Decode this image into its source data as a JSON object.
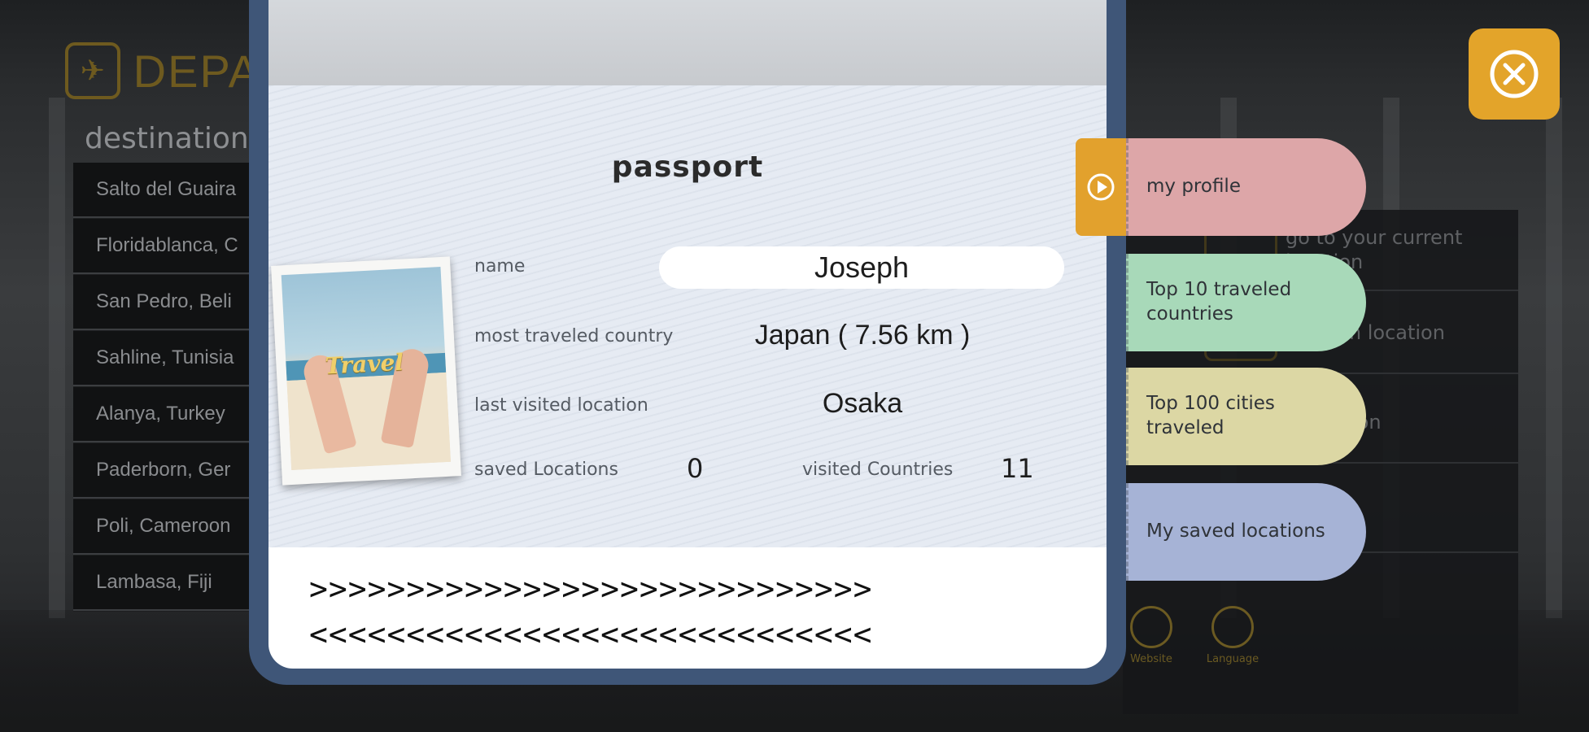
{
  "background": {
    "header_text": "DEPA",
    "destinations_title": "destination",
    "destinations": [
      "Salto del Guaira",
      "Floridablanca, C",
      "San Pedro, Beli",
      "Sahline, Tunisia",
      "Alanya, Turkey",
      "Paderborn, Ger",
      "Poli, Cameroon",
      "Lambasa, Fiji"
    ],
    "right_menu": [
      {
        "label": "go to your current location"
      },
      {
        "label": "random location"
      },
      {
        "label": "a location"
      },
      {
        "label": "rt"
      }
    ],
    "bottom_icons": [
      {
        "label": "Website",
        "icon": "website-icon"
      },
      {
        "label": "Language",
        "icon": "globe-icon"
      }
    ]
  },
  "passport": {
    "title": "passport",
    "photo_caption": "Travel",
    "name_label": "name",
    "name_value": "Joseph",
    "most_traveled_label": "most traveled country",
    "most_traveled_value": "Japan ( 7.56 km )",
    "last_visited_label": "last visited location",
    "last_visited_value": "Osaka",
    "saved_locations_label": "saved Locations",
    "saved_locations_value": "0",
    "visited_countries_label": "visited Countries",
    "visited_countries_value": "11",
    "mrz_line1": ">>>>>>>>>>>>>>>>>>>>>>>>>>>>>",
    "mrz_line2": "<<<<<<<<<<<<<<<<<<<<<<<<<<<<<"
  },
  "tabs": [
    {
      "label": "my profile",
      "color": "#dda6a8"
    },
    {
      "label": "Top 10 traveled countries",
      "color": "#a8d9b9"
    },
    {
      "label": "Top 100 cities traveled",
      "color": "#dcd7a4"
    },
    {
      "label": "My saved locations",
      "color": "#a6b3d6"
    }
  ],
  "colors": {
    "accent": "#e3a42a",
    "passport_frame": "#3f5678"
  }
}
